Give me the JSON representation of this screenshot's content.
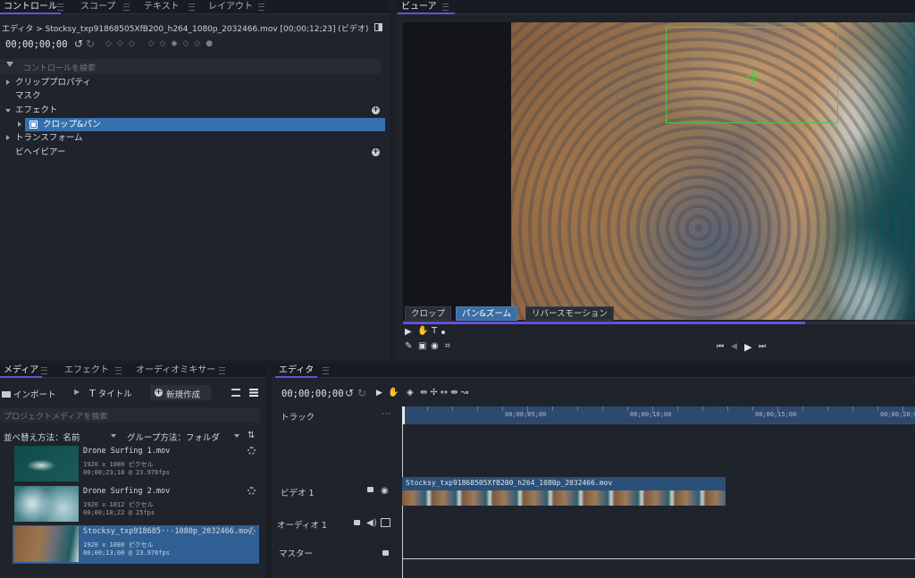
{
  "controls_panel": {
    "tabs": [
      "コントロール",
      "スコープ",
      "テキスト",
      "レイアウト"
    ],
    "breadcrumb": "エディタ > Stocksy_txp91868505XfB200_h264_1080p_2032466.mov [00;00;12;23] (ビデオ)",
    "timecode": "00;00;00;00",
    "search_placeholder": "コントロールを検索",
    "tree": {
      "clip_properties": "クリッププロパティ",
      "mask": "マスク",
      "effects": "エフェクト",
      "crop_pan": "クロップ&パン",
      "transform": "トランスフォーム",
      "behavior": "ビヘイビアー"
    }
  },
  "viewer": {
    "tab": "ビューア",
    "subtabs": [
      "クロップ",
      "パン&ズーム",
      "リバースモーション"
    ],
    "active_subtab": "パン&ズーム",
    "colors": {
      "crop_box": "#3ecf3e",
      "accent": "#6b4fd8"
    }
  },
  "media_panel": {
    "tabs": [
      "メディア",
      "エフェクト",
      "オーディオミキサー"
    ],
    "import_label": "インポート",
    "title_label": "タイトル",
    "new_label": "新規作成",
    "search_placeholder": "プロジェクトメディアを検索",
    "sort_label": "並べ替え方法：名前",
    "group_label": "グループ方法：フォルダ",
    "items": [
      {
        "name": "Drone Surfing 1.mov",
        "res": "1920 x 1080 ピクセル",
        "dur": "00;00;23;18 @ 23.976fps"
      },
      {
        "name": "Drone Surfing 2.mov",
        "res": "1920 x 1012 ピクセル",
        "dur": "00;00;18;22 @ 25fps"
      },
      {
        "name": "Stocksy_txp918685···1080p_2032466.mov",
        "res": "1920 x 1080 ピクセル",
        "dur": "00;00;13;00 @ 23.976fps"
      }
    ]
  },
  "editor": {
    "tab": "エディタ",
    "timecode": "00;00;00;00",
    "tracks_label": "トラック",
    "video_track": "ビデオ 1",
    "audio_track": "オーディオ 1",
    "master_track": "マスター",
    "ruler_labels": [
      "00;00;05;00",
      "00;00;10;00",
      "00;00;15;00",
      "00;00;20;0"
    ],
    "clip_name": "Stocksy_txp91868505XfB200_h264_1080p_2032466.mov"
  }
}
